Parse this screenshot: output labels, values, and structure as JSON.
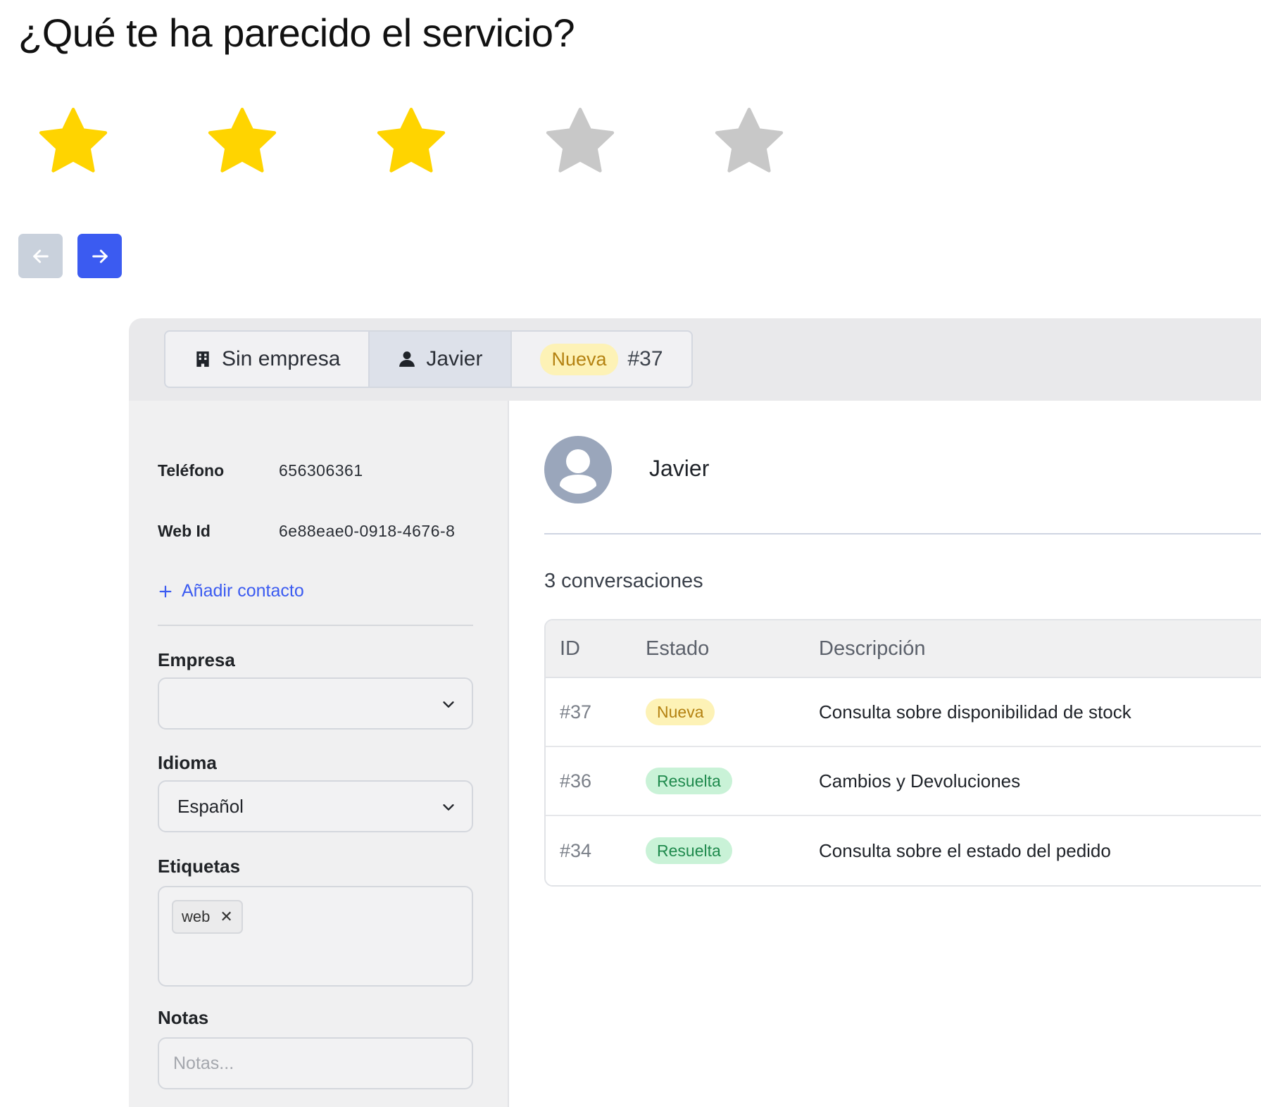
{
  "rating": {
    "question": "¿Qué te ha parecido el servicio?",
    "max": 5,
    "value": 3,
    "filled_color": "#FFD400",
    "empty_color": "#C8C8C8"
  },
  "navigation": {
    "prev_icon": "arrow-left-icon",
    "next_icon": "arrow-right-icon",
    "prev_color": "#C9D1DC",
    "next_color": "#3B5BF1"
  },
  "header": {
    "tabs": [
      {
        "icon": "building-icon",
        "label": "Sin empresa"
      },
      {
        "icon": "user-icon",
        "label": "Javier"
      },
      {
        "badge": "Nueva",
        "label": "#37"
      }
    ]
  },
  "contact": {
    "fields": [
      {
        "label": "Teléfono",
        "value": "656306361"
      },
      {
        "label": "Web Id",
        "value": "6e88eae0-0918-4676-8"
      }
    ],
    "add_contact": "Añadir contacto",
    "company_label": "Empresa",
    "company_value": "",
    "language_label": "Idioma",
    "language_value": "Español",
    "tags_label": "Etiquetas",
    "tags": [
      "web"
    ],
    "notes_label": "Notas",
    "notes_placeholder": "Notas..."
  },
  "profile": {
    "name": "Javier",
    "conversations_count": "3 conversaciones"
  },
  "conversations": {
    "columns": [
      "ID",
      "Estado",
      "Descripción"
    ],
    "rows": [
      {
        "id": "#37",
        "status": "Nueva",
        "description": "Consulta sobre disponibilidad de stock"
      },
      {
        "id": "#36",
        "status": "Resuelta",
        "description": "Cambios y Devoluciones"
      },
      {
        "id": "#34",
        "status": "Resuelta",
        "description": "Consulta sobre el estado del pedido"
      }
    ]
  }
}
